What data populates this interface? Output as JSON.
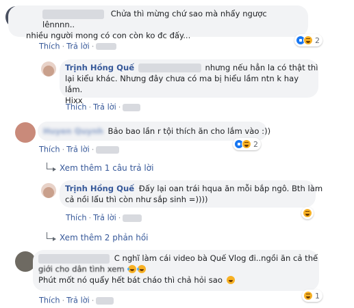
{
  "comments": [
    {
      "author": "",
      "text_line1": "Chửa thì mừng chứ sao mà nhẩy ngược lênnnn..",
      "text_line2": "nhiều người mong có con còn ko đc đấy...",
      "like_label": "Thích",
      "reply_label": "Trả lời",
      "reaction_count": "2",
      "avatar_color": "#4a5060"
    },
    {
      "author": "Trịnh Hồng Quế",
      "text_line1": "nhưng nếu hẳn la có thật thì",
      "text_line2": "lại kiểu khác. Nhưng đây chưa có ma bị hiểu lầm ntn k hay lắm.",
      "text_line3": "Hixx",
      "like_label": "Thích",
      "reply_label": "Trả lời",
      "avatar_color": "#c9a08c"
    },
    {
      "author": "Huyen Quynh",
      "text_line1": "Bảo bao lần r tội thích ăn cho lắm vào :))",
      "like_label": "Thích",
      "reply_label": "Trả lời",
      "reaction_count": "2",
      "avatar_color": "#c98a7a"
    },
    {
      "author": "Trịnh Hồng Quế",
      "text_line1": "Đấy lại oan trái hqua ăn mỗi bắp ngô. Bth làm",
      "text_line2": "cả nồi lẩu thì còn như sắp sinh =))))",
      "like_label": "Thích",
      "reply_label": "Trả lời",
      "avatar_color": "#c9a08c"
    },
    {
      "author": "",
      "text_line1": "C nghĩ làm cái video bà Quế Vlog đi..ngồi ăn cả thế",
      "text_line2": "giới cho dân tình xem",
      "text_line3": "Phút mốt nó quẩy hết bát cháo thì chả hỏi sao",
      "like_label": "Thích",
      "reply_label": "Trả lời",
      "reaction_count": "1",
      "avatar_color": "#6e6a62"
    }
  ],
  "view_more_1": "Xem thêm 1 câu trả lời",
  "view_more_2": "Xem thêm 2 phản hồi",
  "colors": {
    "link": "#365899",
    "bubble": "#f2f3f5",
    "like": "#1877f2",
    "haha": "#f7b125"
  }
}
